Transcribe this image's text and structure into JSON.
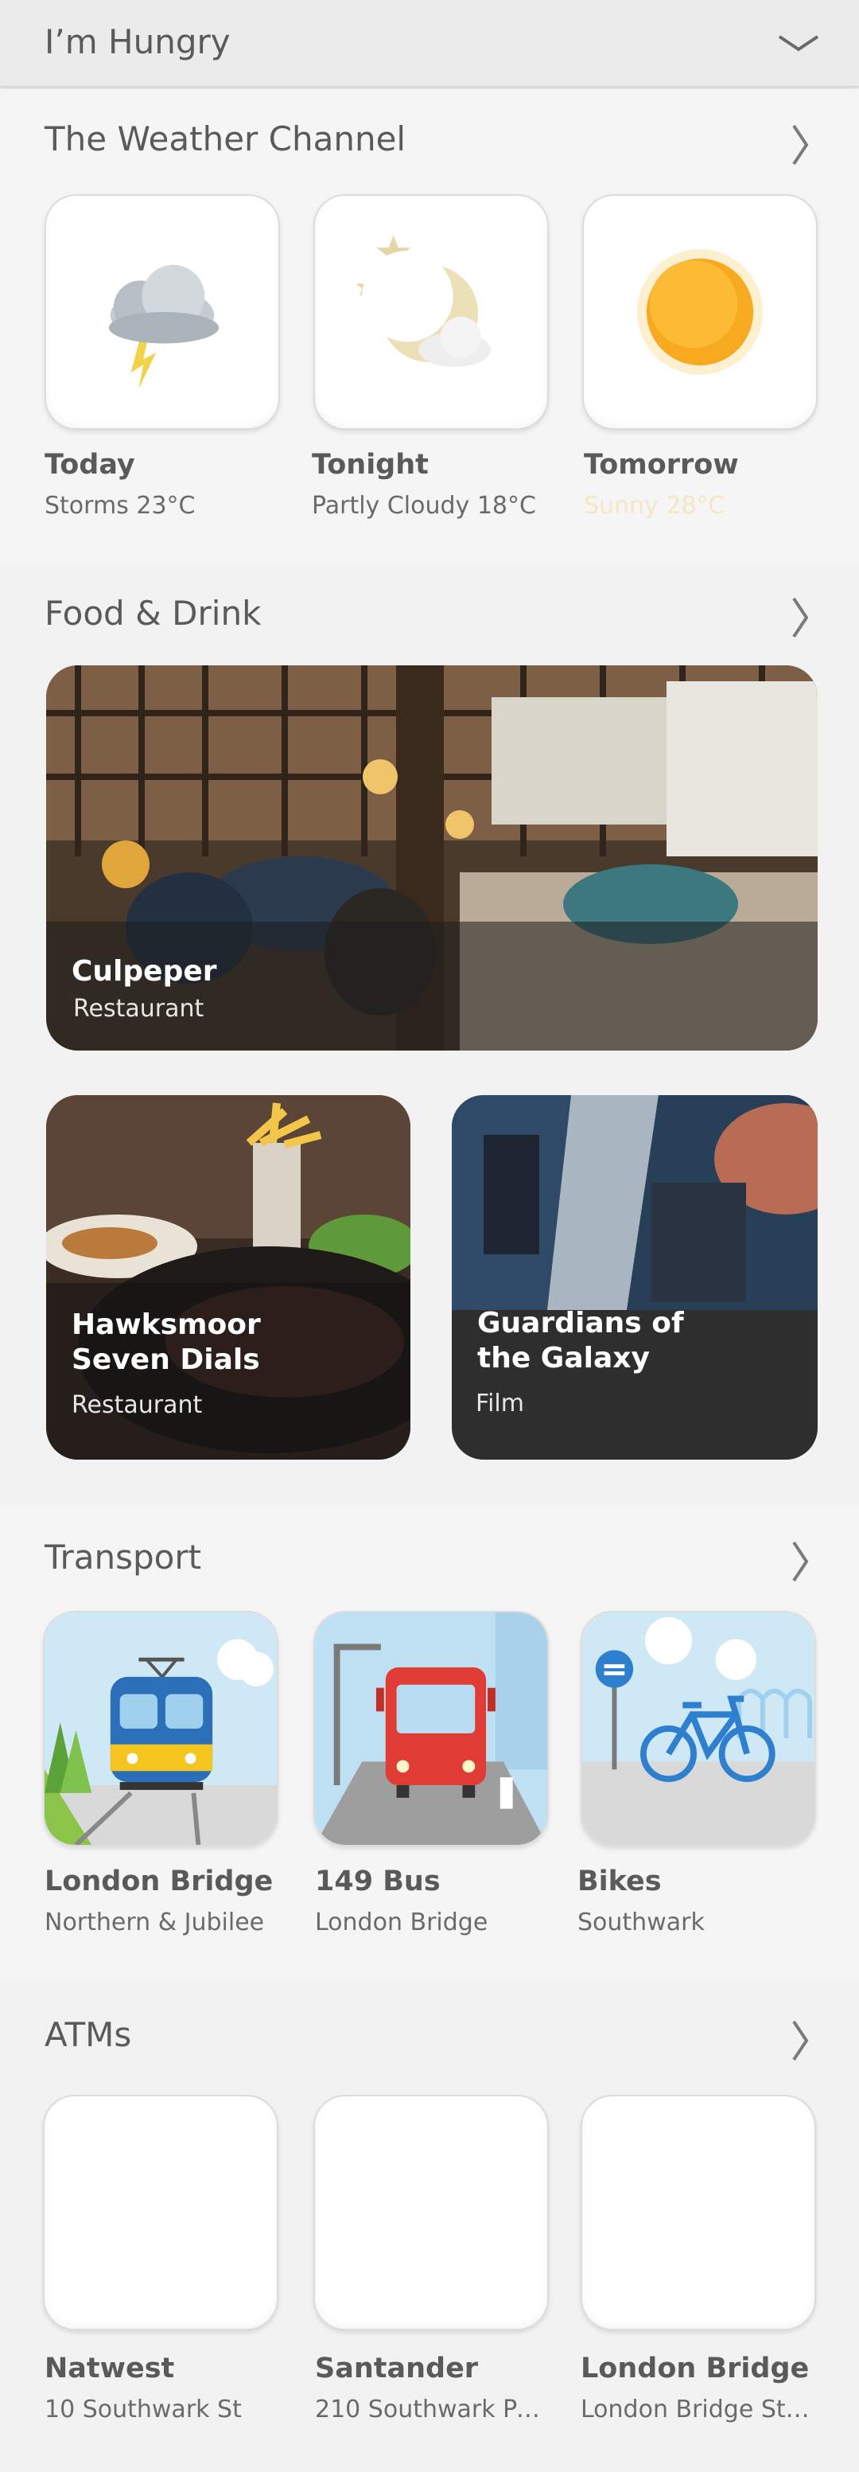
{
  "header": {
    "title": "I’m Hungry",
    "chevron_icon": "chevron-down-icon"
  },
  "weather": {
    "title": "The Weather Channel",
    "items": [
      {
        "title": "Today",
        "subtitle": "Storms  23°C",
        "icon": "thunderstorm-icon"
      },
      {
        "title": "Tonight",
        "subtitle": "Partly Cloudy 18°C",
        "icon": "moon-cloud-icon"
      },
      {
        "title": "Tomorrow",
        "subtitle": "Sunny 28°C",
        "icon": "sun-icon"
      }
    ]
  },
  "food": {
    "title": "Food & Drink",
    "featured": {
      "title": "Culpeper",
      "subtitle": "Restaurant"
    },
    "cards": [
      {
        "title_line1": "Hawksmoor",
        "title_line2": "Seven Dials",
        "subtitle": "Restaurant"
      },
      {
        "title_line1": "Guardians of",
        "title_line2": "the Galaxy",
        "subtitle": "Film"
      }
    ]
  },
  "transport": {
    "title": "Transport",
    "items": [
      {
        "title": "London Bridge",
        "subtitle": "Northern & Jubilee",
        "icon": "train-icon"
      },
      {
        "title": "149 Bus",
        "subtitle": "London Bridge",
        "icon": "bus-icon"
      },
      {
        "title": "Bikes",
        "subtitle": "Southwark",
        "icon": "bike-icon"
      }
    ]
  },
  "atms": {
    "title": "ATMs",
    "items": [
      {
        "title": "Natwest",
        "subtitle": "10 Southwark St"
      },
      {
        "title": "Santander",
        "subtitle": "210 Southwark Par..."
      },
      {
        "title": "London Bridge",
        "subtitle": "London Bridge Stat..."
      }
    ]
  },
  "colors": {
    "background": "#f2f2f2",
    "text": "#5a5a5a",
    "sunny_text": "#f3e7c4",
    "sky": "#cfe8f5"
  }
}
